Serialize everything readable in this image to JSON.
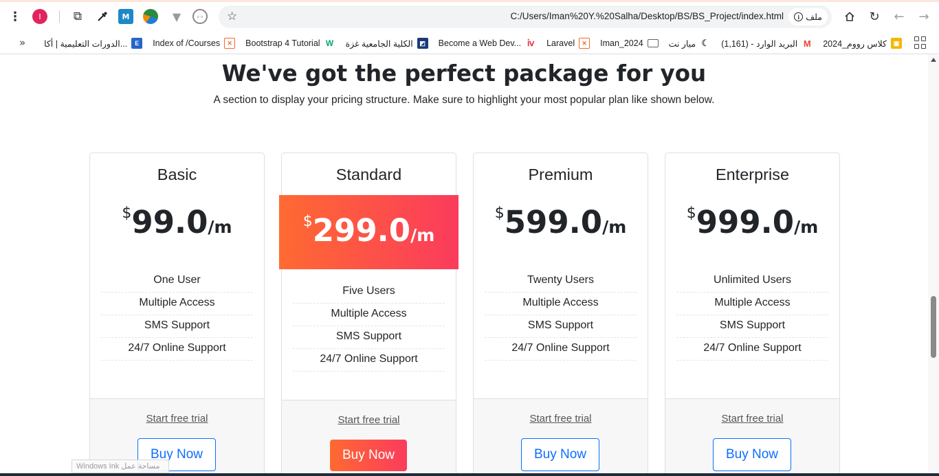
{
  "browser": {
    "url": "C:/Users/Iman%20Y.%20Salha/Desktop/BS/BS_Project/index.html",
    "file_chip": "ملف",
    "profile_initial": "I",
    "bookmarks": [
      {
        "label": "كلاس رووم_2024",
        "icon": "classroom-icon",
        "color": "#f2b705"
      },
      {
        "label": "البريد الوارد - (1,161)",
        "icon": "gmail-icon",
        "color": "#ea4335"
      },
      {
        "label": "ميار نت",
        "icon": "moon-icon",
        "color": "#555555"
      },
      {
        "label": "Iman_2024",
        "icon": "folder-icon",
        "color": "#5f6368"
      },
      {
        "label": "Laravel",
        "icon": "xampp-icon",
        "color": "#f46b2a"
      },
      {
        "label": "Become a Web Dev...",
        "icon": "udemy-icon",
        "color": "#e8323e"
      },
      {
        "label": "الكلية الجامعية غزة",
        "icon": "ucas-icon",
        "color": "#1b3a7a"
      },
      {
        "label": "Bootstrap 4 Tutorial",
        "icon": "w3schools-icon",
        "color": "#04aa6d"
      },
      {
        "label": "Index of /Courses",
        "icon": "xampp-icon",
        "color": "#f46b2a"
      },
      {
        "label": "الدورات التعليمية | أكا...",
        "icon": "edraak-icon",
        "color": "#2766c9"
      }
    ]
  },
  "section": {
    "heading": "We've got the perfect package for you",
    "subheading": "A section to display your pricing structure. Make sure to highlight your most popular plan like shown below."
  },
  "plans": [
    {
      "title": "Basic",
      "currency": "$",
      "amount": "99.0",
      "period": "/m",
      "popular": false,
      "features": [
        "One User",
        "Multiple Access",
        "SMS Support",
        "24/7 Online Support"
      ],
      "trial": "Start free trial",
      "buy": "Buy Now"
    },
    {
      "title": "Standard",
      "currency": "$",
      "amount": "299.0",
      "period": "/m",
      "popular": true,
      "features": [
        "Five Users",
        "Multiple Access",
        "SMS Support",
        "24/7 Online Support"
      ],
      "trial": "Start free trial",
      "buy": "Buy Now"
    },
    {
      "title": "Premium",
      "currency": "$",
      "amount": "599.0",
      "period": "/m",
      "popular": false,
      "features": [
        "Twenty Users",
        "Multiple Access",
        "SMS Support",
        "24/7 Online Support"
      ],
      "trial": "Start free trial",
      "buy": "Buy Now"
    },
    {
      "title": "Enterprise",
      "currency": "$",
      "amount": "999.0",
      "period": "/m",
      "popular": false,
      "features": [
        "Unlimited Users",
        "Multiple Access",
        "SMS Support",
        "24/7 Online Support"
      ],
      "trial": "Start free trial",
      "buy": "Buy Now"
    }
  ],
  "colors": {
    "accent_start": "#ff6a32",
    "accent_end": "#fb3b5c",
    "button_blue": "#0d6efd"
  },
  "overlay": {
    "ink_tooltip": "Windows Ink مساحة عمل"
  }
}
